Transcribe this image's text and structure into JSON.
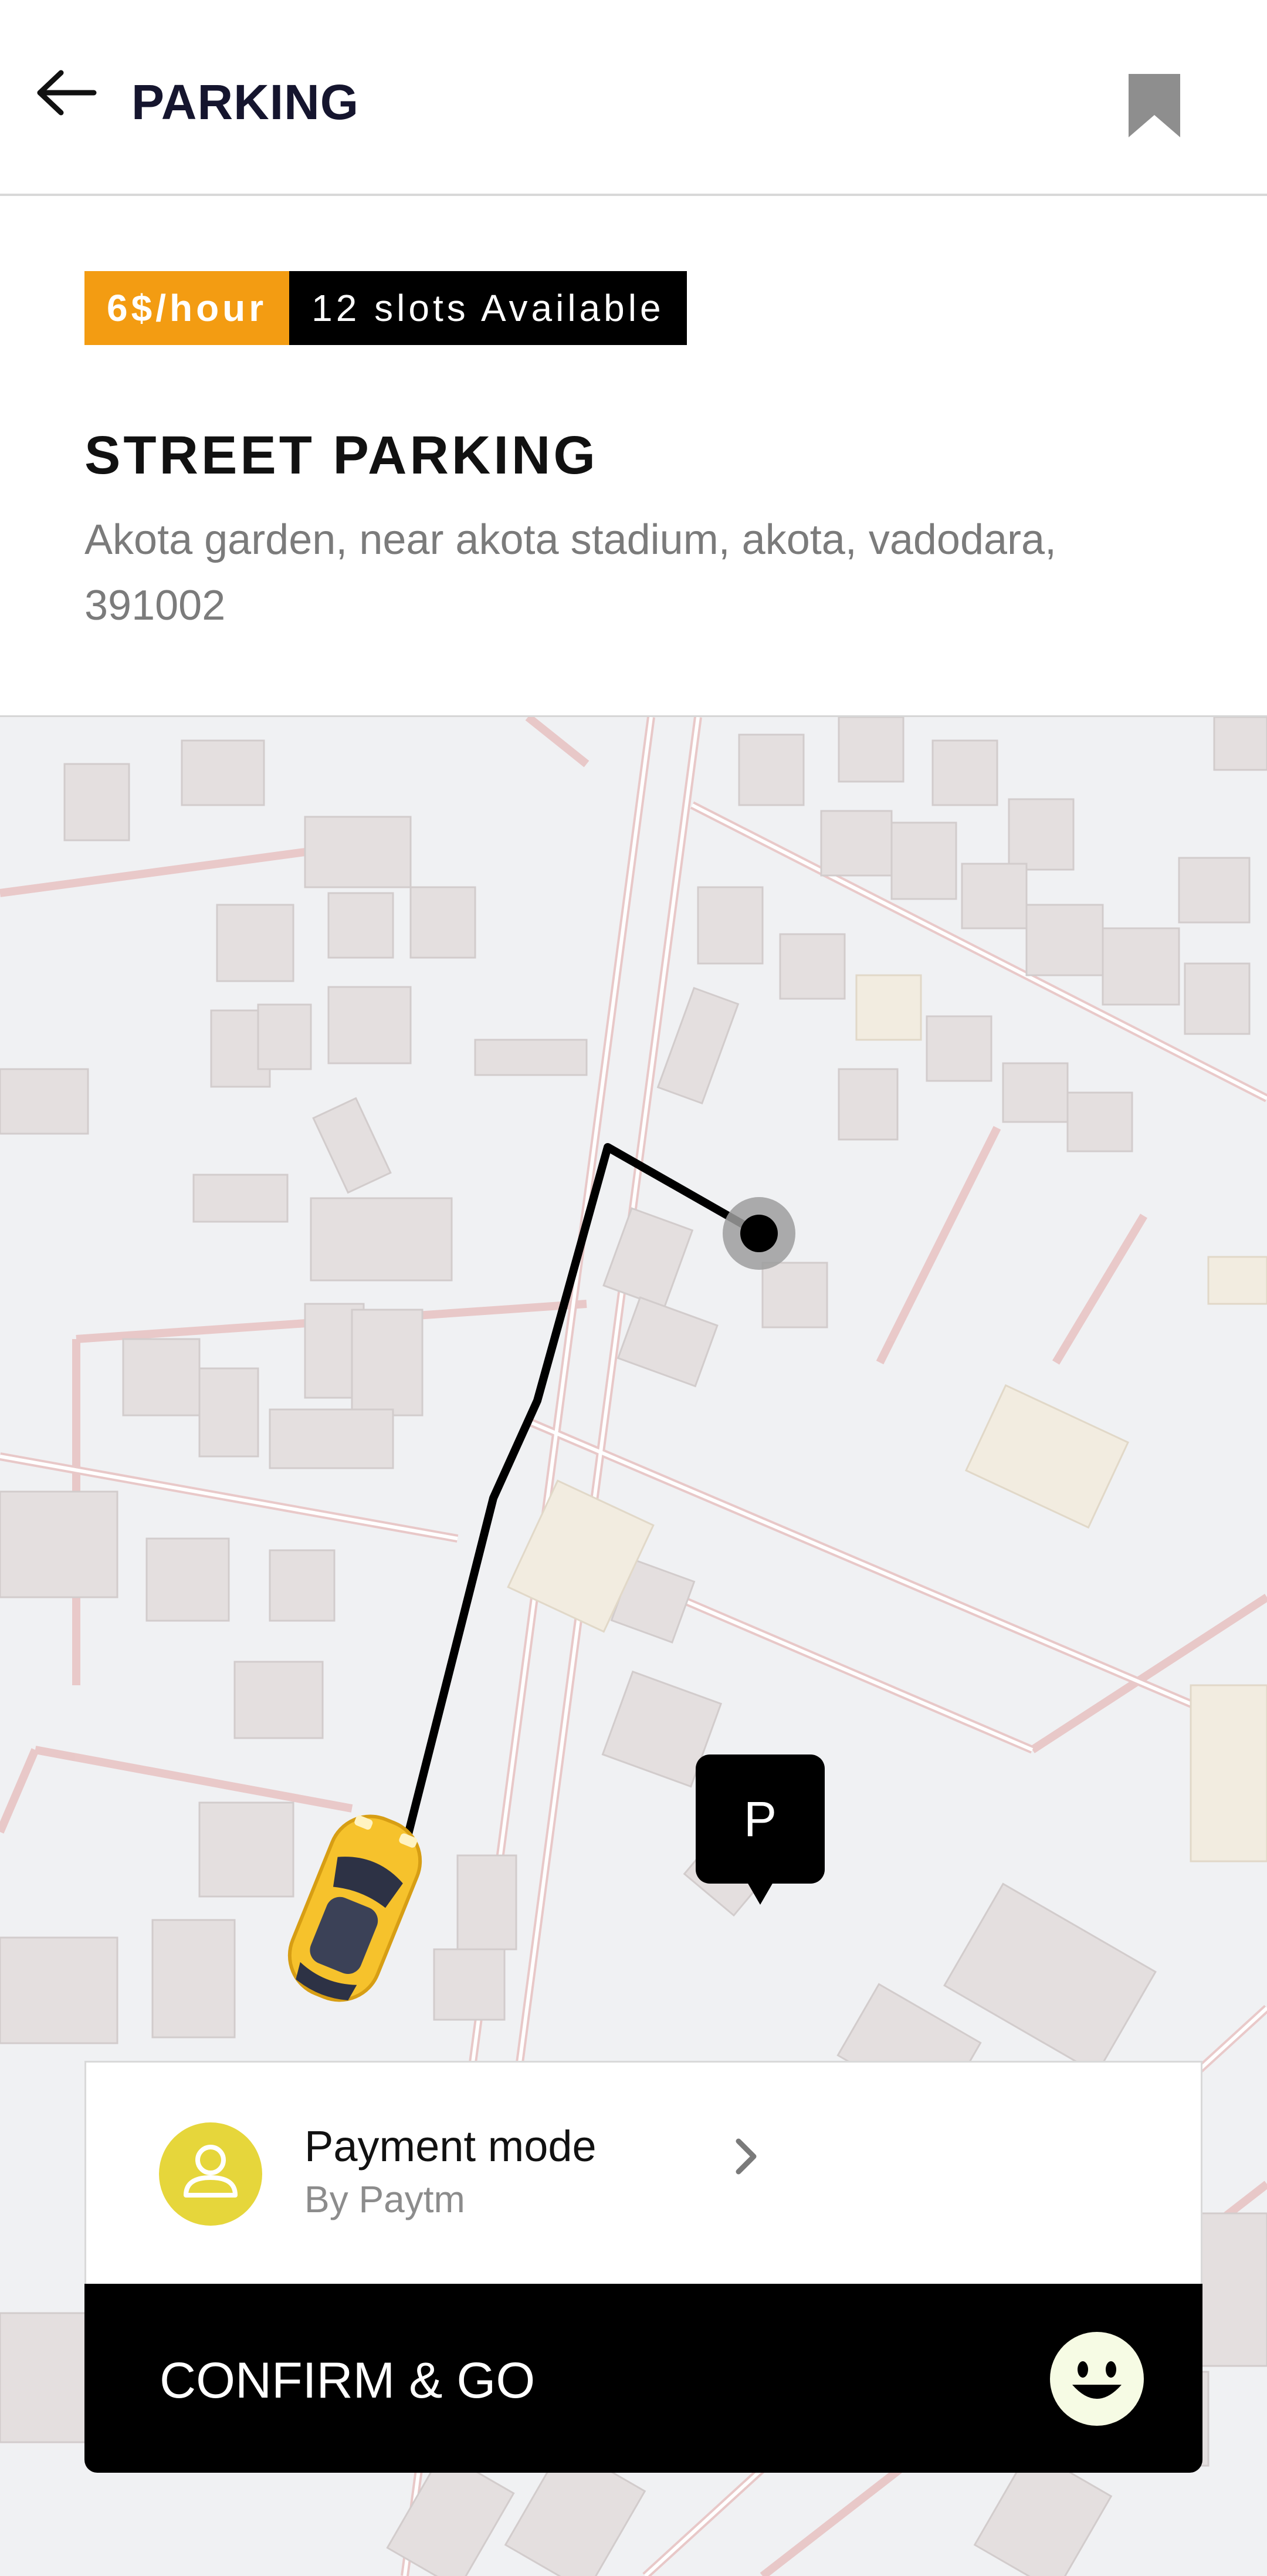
{
  "header": {
    "title": "PARKING",
    "back_icon": "arrow-left-icon",
    "bookmark_icon": "bookmark-icon"
  },
  "parking": {
    "price": "6$/hour",
    "slots": "12 slots Available",
    "name": "STREET PARKING",
    "address": "Akota garden, near akota stadium, akota, vadodara, 391002"
  },
  "map": {
    "marker_label": "P",
    "vehicle_icon": "car-icon",
    "route_color": "#000000"
  },
  "payment": {
    "title": "Payment mode",
    "method": "By Paytm",
    "avatar_icon": "user-icon",
    "chevron_icon": "chevron-right-icon"
  },
  "action": {
    "confirm_label": "CONFIRM & GO",
    "emoji_icon": "smiley-icon"
  },
  "colors": {
    "price_badge": "#f39c12",
    "slots_badge": "#000000",
    "avatar_bg": "#e6d63b",
    "car_body": "#f6c22c"
  }
}
